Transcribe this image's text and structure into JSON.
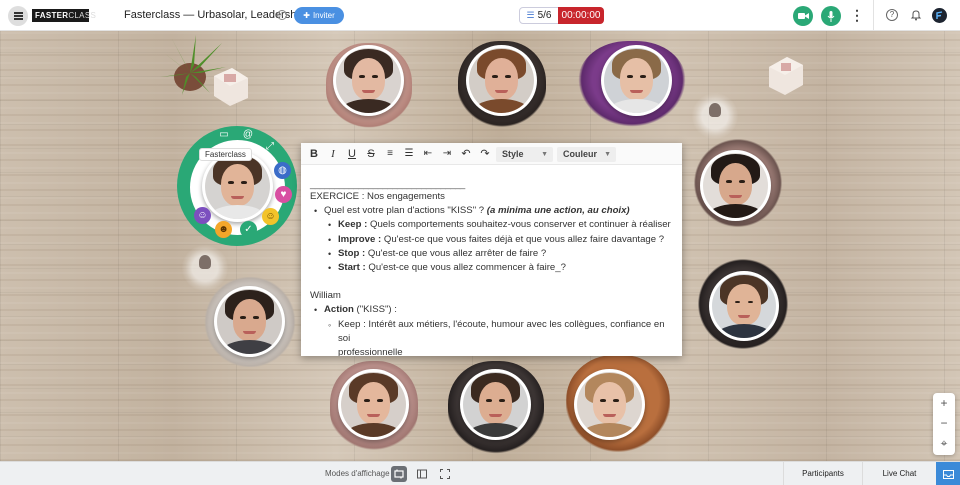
{
  "topbar": {
    "logo_bold": "FASTER",
    "logo_thin": "CLASS",
    "title": "Fasterclass — Urbasolar, Leadership",
    "invite_label": "Inviter",
    "step": "5/6",
    "timer": "00:00:00"
  },
  "ring_menu": {
    "label": "Fasterclass"
  },
  "editor": {
    "toolbar": {
      "style_label": "Style",
      "color_label": "Couleur"
    },
    "separator": "________________________________",
    "exercise_title": "EXERCICE : Nos engagements",
    "question": "Quel est votre plan d'actions \"KISS\" ? ",
    "question_hint": "(a minima une action, au choix)",
    "items": [
      {
        "label": "Keep :",
        "text": " Quels comportements souhaitez-vous conserver et continuer à réaliser"
      },
      {
        "label": "Improve :",
        "text": " Qu'est-ce que vous faites déjà et que vous allez faire davantage ?"
      },
      {
        "label": "Stop :",
        "text": " Qu'est-ce que vous allez arrêter de faire ?"
      },
      {
        "label": "Start :",
        "text": " Qu'est-ce que vous allez commencer à faire_?"
      }
    ],
    "participant_name": "William",
    "action_label": "Action",
    "action_suffix": " (\"KISS\") :",
    "answer_line1": "Keep : Intérêt aux métiers, l'écoute, humour avec les collègues, confiance en soi",
    "answer_line2": "professionnelle"
  },
  "bottombar": {
    "modes_label": "Modes d'affichage",
    "participants_tab": "Participants",
    "chat_tab": "Live Chat"
  },
  "zoom": {
    "zoom_in": "+",
    "zoom_out": "−",
    "recenter": "⌖"
  },
  "colors": {
    "accent_green": "#2aa876",
    "invite_blue": "#4a90e2",
    "timer_red": "#c8252c"
  }
}
